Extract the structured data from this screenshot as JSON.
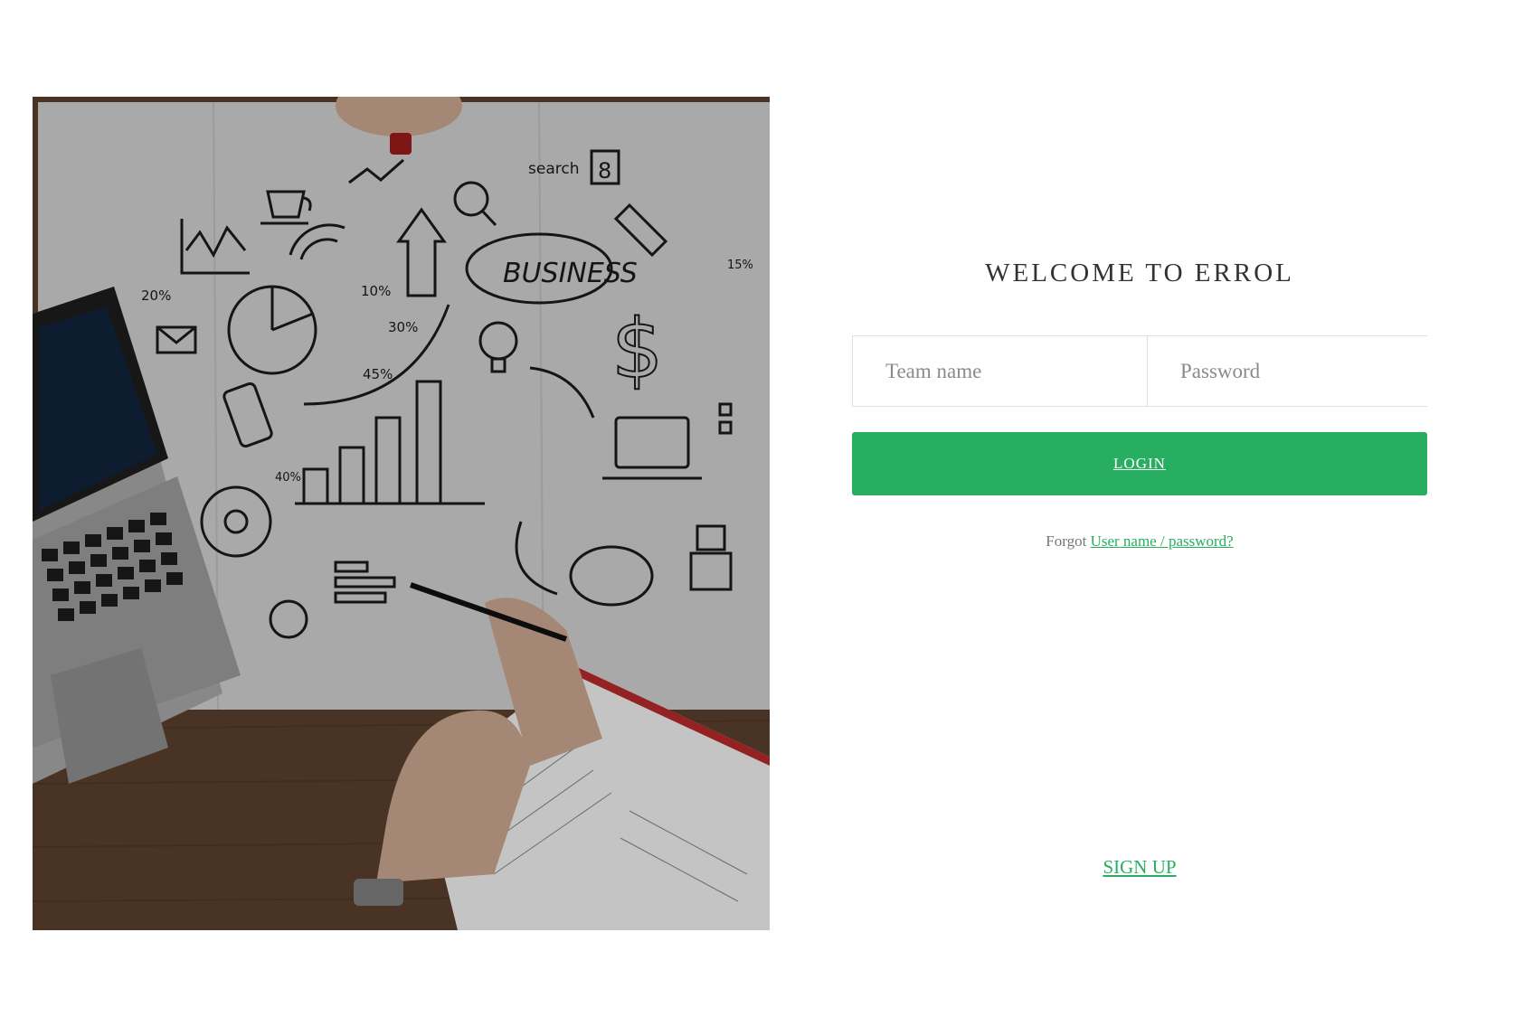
{
  "hero": {
    "sketch_title": "BUSINESS",
    "sketch_search": "search",
    "sketch_calendar_day": "8",
    "sketch_pct_20": "20%",
    "sketch_pct_10": "10%",
    "sketch_pct_30": "30%",
    "sketch_pct_45": "45%",
    "sketch_pct_40": "40%",
    "sketch_pct_15": "15%"
  },
  "login": {
    "title": "WELCOME TO ERROL",
    "team_placeholder": "Team name",
    "password_placeholder": "Password",
    "login_label": "LOGIN",
    "forgot_prefix": "Forgot",
    "forgot_link": "User name / password?",
    "signup_label": "SIGN UP"
  },
  "colors": {
    "accent": "#27ae60",
    "title_text": "#333333",
    "field_border": "#dedede",
    "placeholder": "#8a8a8a"
  }
}
